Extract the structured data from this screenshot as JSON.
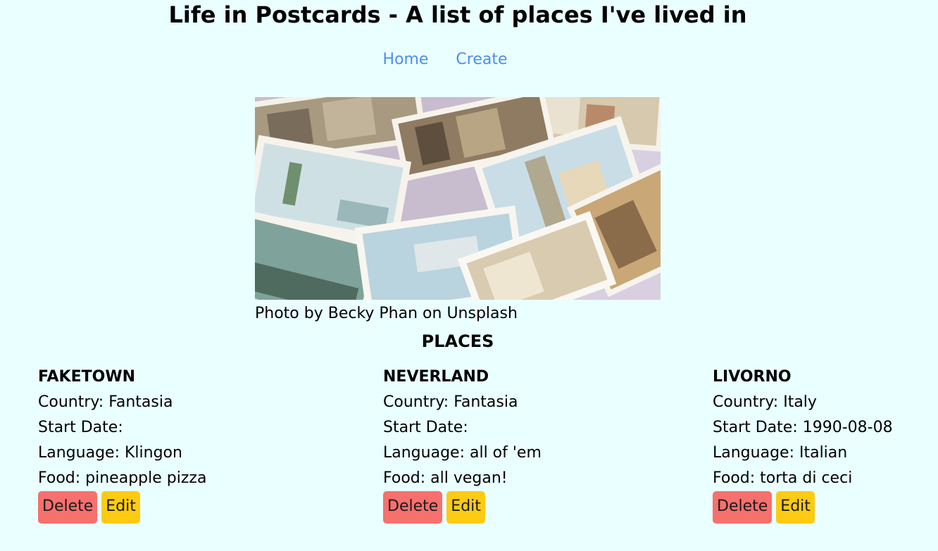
{
  "header": {
    "title": "Life in Postcards - A list of places I've lived in"
  },
  "nav": {
    "items": [
      {
        "label": "Home"
      },
      {
        "label": "Create"
      }
    ]
  },
  "hero": {
    "caption": "Photo by Becky Phan on Unsplash"
  },
  "places": {
    "title": "PLACES",
    "items": [
      {
        "name": "FAKETOWN",
        "country": "Country: Fantasia",
        "start_date": "Start Date:",
        "language": "Language: Klingon",
        "food": "Food: pineapple pizza",
        "delete_label": "Delete",
        "edit_label": "Edit"
      },
      {
        "name": "NEVERLAND",
        "country": "Country: Fantasia",
        "start_date": "Start Date:",
        "language": "Language: all of 'em",
        "food": "Food: all vegan!",
        "delete_label": "Delete",
        "edit_label": "Edit"
      },
      {
        "name": "LIVORNO",
        "country": "Country: Italy",
        "start_date": "Start Date: 1990-08-08",
        "language": "Language: Italian",
        "food": "Food: torta di ceci",
        "delete_label": "Delete",
        "edit_label": "Edit"
      }
    ]
  },
  "colors": {
    "background": "#eaffff",
    "link": "#4a8ef2",
    "delete_button": "#f6706e",
    "edit_button": "#fccb12"
  }
}
